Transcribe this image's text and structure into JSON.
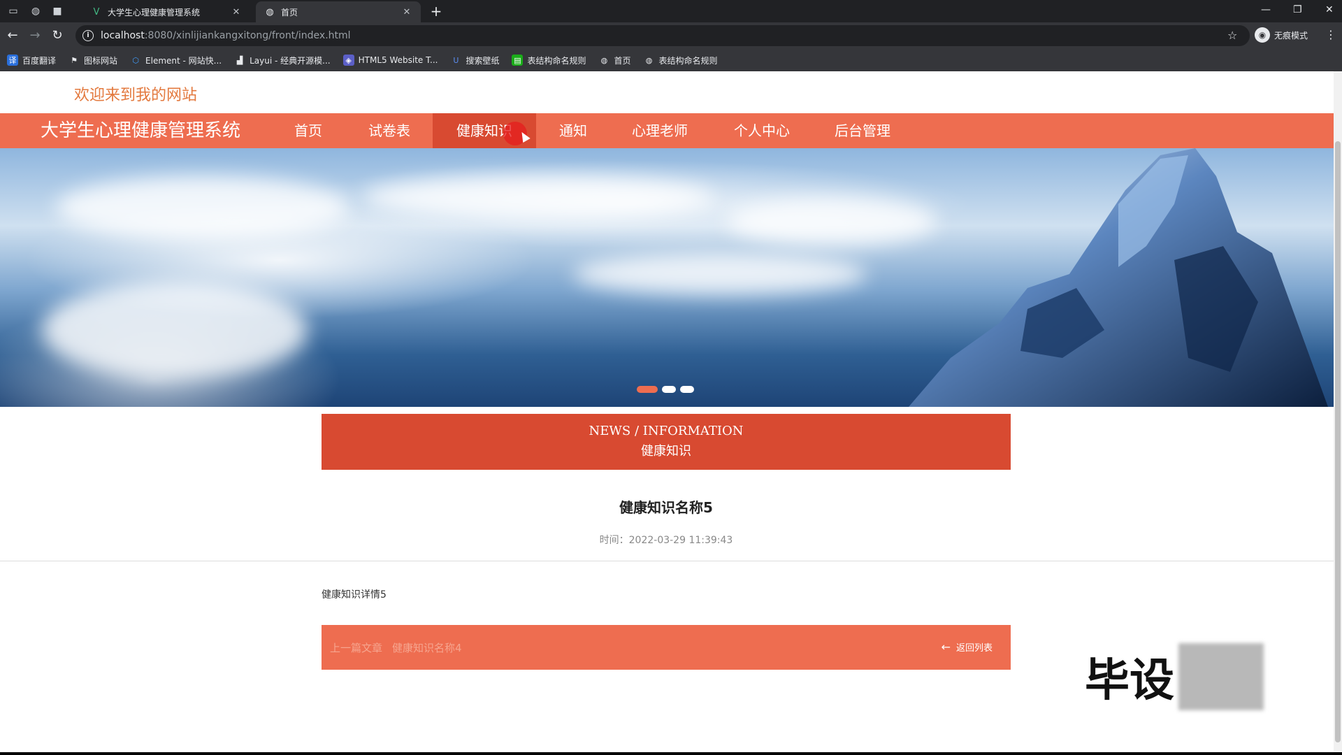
{
  "browser": {
    "tabs": [
      {
        "title": "大学生心理健康管理系统",
        "active": false
      },
      {
        "title": "首页",
        "active": true
      }
    ],
    "url_host": "localhost",
    "url_path": ":8080/xinlijiankangxitong/front/index.html",
    "profile_label": "无痕模式",
    "bookmarks": [
      {
        "label": "百度翻译"
      },
      {
        "label": "图标网站"
      },
      {
        "label": "Element - 网站快..."
      },
      {
        "label": "Layui - 经典开源模..."
      },
      {
        "label": "HTML5 Website T..."
      },
      {
        "label": "搜索壁纸"
      },
      {
        "label": "表结构命名规则"
      },
      {
        "label": "首页"
      },
      {
        "label": "表结构命名规则"
      }
    ]
  },
  "site": {
    "welcome": "欢迎来到我的网站",
    "brand": "大学生心理健康管理系统",
    "nav": [
      {
        "label": "首页"
      },
      {
        "label": "试卷表"
      },
      {
        "label": "健康知识",
        "active": true
      },
      {
        "label": "通知"
      },
      {
        "label": "心理老师"
      },
      {
        "label": "个人中心"
      },
      {
        "label": "后台管理"
      }
    ],
    "carousel": {
      "slides": 3,
      "active_index": 0
    }
  },
  "news_header": {
    "en": "NEWS / INFORMATION",
    "zh": "健康知识"
  },
  "article": {
    "title": "健康知识名称5",
    "time": "时间：2022-03-29 11:39:43",
    "body": "健康知识详情5"
  },
  "pager": {
    "prev_label": "上一篇文章",
    "prev_title": "健康知识名称4",
    "back_label": "返回列表"
  },
  "watermark": "毕设",
  "colors": {
    "accent": "#ee6d50",
    "accent_dark": "#d84a31",
    "welcome": "#e3793e"
  }
}
